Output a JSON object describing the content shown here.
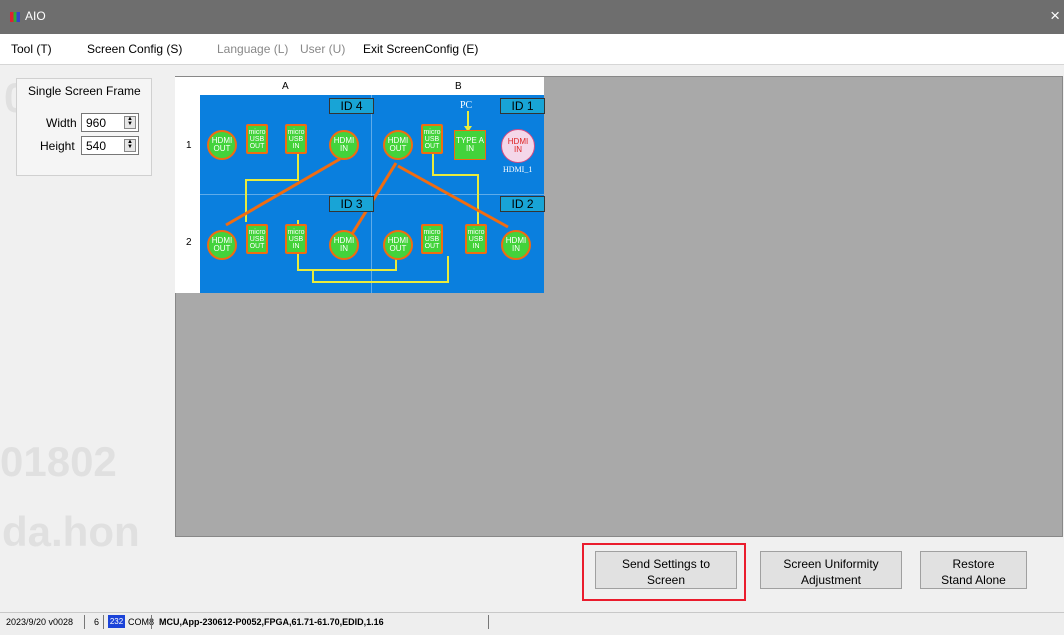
{
  "window": {
    "title": "AIO",
    "close_symbol": "×"
  },
  "menu": {
    "items": [
      {
        "label": "Tool (T)",
        "disabled": false
      },
      {
        "label": "Screen Config (S)",
        "disabled": false
      },
      {
        "label": "Language (L)",
        "disabled": true
      },
      {
        "label": "User (U)",
        "disabled": true
      },
      {
        "label": "Exit ScreenConfig (E)",
        "disabled": false
      }
    ]
  },
  "frame": {
    "title": "Single Screen Frame",
    "width_label": "Width",
    "width_value": "960",
    "height_label": "Height",
    "height_value": "540"
  },
  "grid": {
    "columns": [
      "A",
      "B"
    ],
    "rows": [
      "1",
      "2"
    ],
    "ids": [
      "ID 4",
      "ID 1",
      "ID 3",
      "ID 2"
    ],
    "labels": {
      "pc": "PC",
      "hdmi1": "HDMI_1"
    },
    "ports": {
      "a1_hdmi_out": "HDMI\nOUT",
      "a1_usb_out": "micro\nUSB\nOUT",
      "a1_usb_in": "micro\nUSB\nIN",
      "a1_hdmi_in": "HDMI\nIN",
      "b1_hdmi_out": "HDMI\nOUT",
      "b1_usb_out": "micro\nUSB\nOUT",
      "b1_type_a": "TYPE A\nIN",
      "b1_hdmi_in": "HDMI\nIN",
      "a2_hdmi_out": "HDMI\nOUT",
      "a2_usb_out": "micro\nUSB\nOUT",
      "a2_usb_in": "micro\nUSB\nIN",
      "a2_hdmi_in": "HDMI\nIN",
      "b2_hdmi_out": "HDMI\nOUT",
      "b2_usb_out": "micro\nUSB\nOUT",
      "b2_usb_in": "micro\nUSB\nIN",
      "b2_hdmi_in": "HDMI\nIN"
    }
  },
  "buttons": {
    "send": "Send Settings to\nScreen",
    "uniformity": "Screen Uniformity\nAdjustment",
    "restore": "Restore\nStand Alone"
  },
  "status": {
    "version": "2023/9/20 v0028",
    "count": "6",
    "badge": "232",
    "port": "COM8",
    "firmware": "MCU,App-230612-P0052,FPGA,61.71-61.70,EDID,1.16"
  },
  "watermarks": [
    "0018",
    "N",
    "01802",
    "da.hon"
  ],
  "colors": {
    "accent_highlight": "#ea1c2d",
    "grid_blue": "#0a7fde",
    "port_green": "#43d33b",
    "cable_orange": "#f06c11",
    "cable_yellow": "#e8eb3d"
  }
}
